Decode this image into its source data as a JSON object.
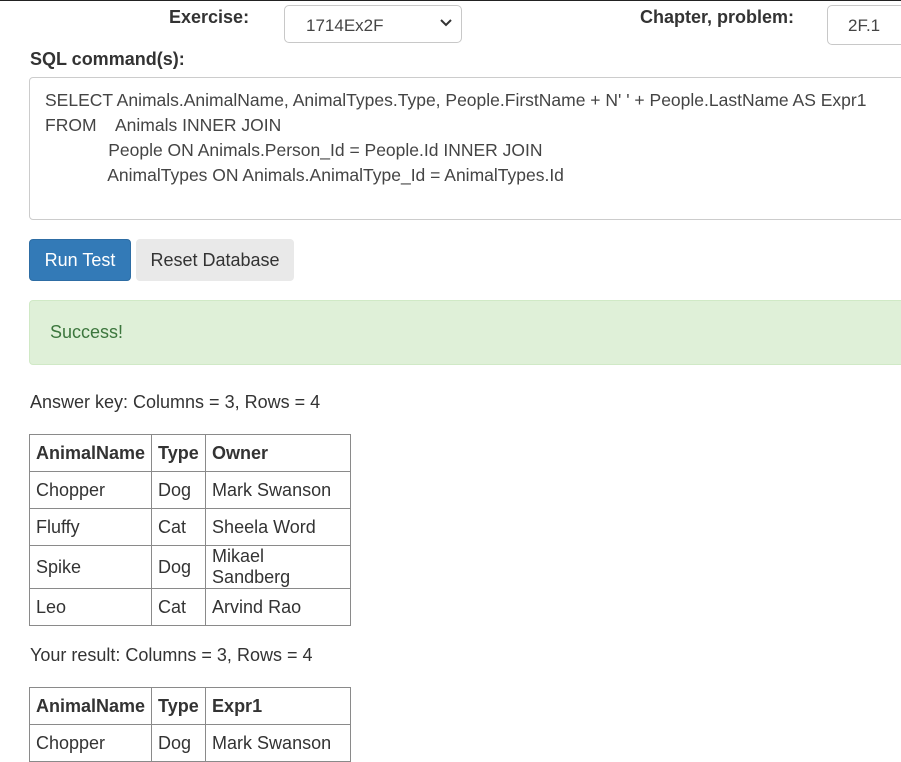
{
  "header": {
    "exercise_label": "Exercise:",
    "exercise_value": "1714Ex2F",
    "chapter_label": "Chapter, problem:",
    "chapter_value": "2F.1"
  },
  "sql": {
    "label": "SQL command(s):",
    "lines": [
      "SELECT Animals.AnimalName, AnimalTypes.Type, People.FirstName + N' ' + People.LastName AS Expr1",
      "FROM    Animals INNER JOIN",
      "             People ON Animals.Person_Id = People.Id INNER JOIN",
      "             AnimalTypes ON Animals.AnimalType_Id = AnimalTypes.Id"
    ]
  },
  "buttons": {
    "run": "Run Test",
    "reset": "Reset Database"
  },
  "alert": {
    "message": "Success!"
  },
  "answer_key": {
    "summary": "Answer key: Columns = 3, Rows = 4",
    "columns": [
      "AnimalName",
      "Type",
      "Owner"
    ],
    "rows": [
      [
        "Chopper",
        "Dog",
        "Mark Swanson"
      ],
      [
        "Fluffy",
        "Cat",
        "Sheela Word"
      ],
      [
        "Spike",
        "Dog",
        "Mikael Sandberg"
      ],
      [
        "Leo",
        "Cat",
        "Arvind Rao"
      ]
    ]
  },
  "your_result": {
    "summary": "Your result: Columns = 3, Rows = 4",
    "columns": [
      "AnimalName",
      "Type",
      "Expr1"
    ],
    "rows": [
      [
        "Chopper",
        "Dog",
        "Mark Swanson"
      ]
    ]
  },
  "colors": {
    "primary": "#337ab7",
    "success_bg": "#dff0d8",
    "success_text": "#3c763d"
  }
}
